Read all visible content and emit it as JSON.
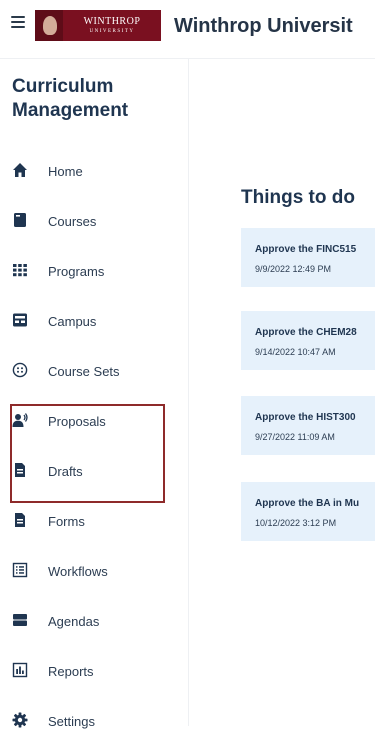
{
  "header": {
    "logo_text": "WINTHROP",
    "logo_subtext": "UNIVERSITY",
    "university_name": "Winthrop Universit"
  },
  "sidebar": {
    "title": "Curriculum Management",
    "items": [
      {
        "label": "Home",
        "icon": "home-icon"
      },
      {
        "label": "Courses",
        "icon": "book-icon"
      },
      {
        "label": "Programs",
        "icon": "grid-icon"
      },
      {
        "label": "Campus",
        "icon": "building-icon"
      },
      {
        "label": "Course Sets",
        "icon": "set-icon"
      },
      {
        "label": "Proposals",
        "icon": "proposal-icon"
      },
      {
        "label": "Drafts",
        "icon": "document-icon"
      },
      {
        "label": "Forms",
        "icon": "form-icon"
      },
      {
        "label": "Workflows",
        "icon": "workflow-icon"
      },
      {
        "label": "Agendas",
        "icon": "agenda-icon"
      },
      {
        "label": "Reports",
        "icon": "report-icon"
      },
      {
        "label": "Settings",
        "icon": "gear-icon"
      }
    ]
  },
  "main": {
    "title": "Things to do",
    "tasks": [
      {
        "title": "Approve the FINC515",
        "date": "9/9/2022 12:49 PM"
      },
      {
        "title": "Approve the CHEM28",
        "date": "9/14/2022 10:47 AM"
      },
      {
        "title": "Approve the HIST300",
        "date": "9/27/2022 11:09 AM"
      },
      {
        "title": "Approve the BA in Mu",
        "date": "10/12/2022 3:12 PM"
      }
    ]
  },
  "colors": {
    "brand": "#7a1020",
    "highlight_border": "#8e2a2a",
    "card_bg": "#e6f1fb",
    "title_text": "#1f3550"
  }
}
